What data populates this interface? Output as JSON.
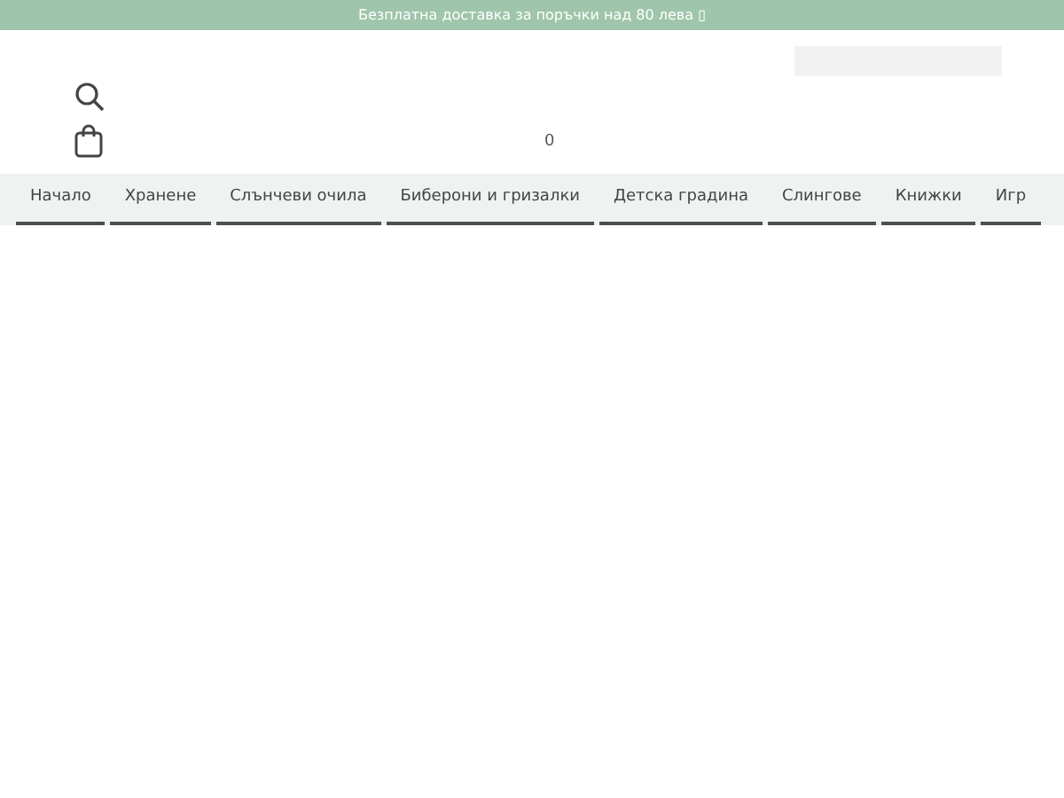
{
  "promo_bar": {
    "text": "Безплатна доставка за поръчки над 80 лева ▯"
  },
  "header": {
    "cart_count": "0"
  },
  "nav": {
    "items": [
      {
        "label": "Начало"
      },
      {
        "label": "Хранене"
      },
      {
        "label": "Слънчеви очила"
      },
      {
        "label": "Биберони и гризалки"
      },
      {
        "label": "Детска градина"
      },
      {
        "label": "Слингове"
      },
      {
        "label": "Книжки"
      },
      {
        "label": "Игр"
      }
    ]
  }
}
